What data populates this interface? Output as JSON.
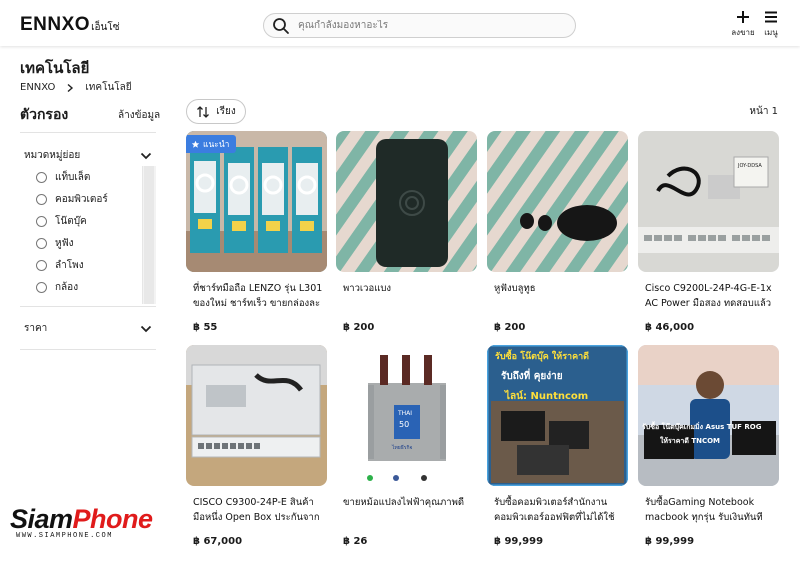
{
  "header": {
    "logo_main": "ENNXO",
    "logo_sub": "เอ็นโซ่",
    "search_placeholder": "คุณกำลังมองหาอะไร",
    "sell_label": "ลงขาย",
    "menu_label": "เมนู"
  },
  "page": {
    "title": "เทคโนโลยี",
    "breadcrumb": [
      "ENNXO",
      "เทคโนโลยี"
    ]
  },
  "sidebar": {
    "filter_title": "ตัวกรอง",
    "clear_label": "ล้างข้อมูล",
    "subcategory_title": "หมวดหมู่ย่อย",
    "subcategories": [
      "แท็บเล็ต",
      "คอมพิวเตอร์",
      "โน๊ตบุ๊ค",
      "หูฟัง",
      "ลำโพง",
      "กล้อง"
    ],
    "price_title": "ราคา"
  },
  "toolbar": {
    "sort_label": "เรียง",
    "page_label": "หน้า 1"
  },
  "products": [
    {
      "name": "ที่ชาร์ทมือถือ LENZO รุ่น L301 ของใหม่ ชาร์ทเร็ว ขายกล่องละ",
      "price": "฿ 55",
      "badge": "แนะนำ"
    },
    {
      "name": "พาวเวอแบง",
      "price": "฿ 200"
    },
    {
      "name": "หูฟังบลูทูธ",
      "price": "฿ 200"
    },
    {
      "name": "Cisco C9200L-24P-4G-E-1x AC Power มือสอง ทดสอบแล้ว",
      "price": "฿ 46,000"
    },
    {
      "name": "CISCO C9300-24P-E สินค้ามือหนึ่ง Open Box ประกันจากผู้",
      "price": "฿ 67,000"
    },
    {
      "name": "ขายหม้อแปลงไฟฟ้าคุณภาพดี",
      "price": "฿ 26"
    },
    {
      "name": "รับซื้อคอมพิวเตอร์สำนักงาน คอมพิวเตอร์ออฟฟิตที่ไม่ได้ใช้",
      "price": "฿ 99,999"
    },
    {
      "name": "รับซื้อGaming Notebook macbook ทุกรุ่น รับเงินทันที",
      "price": "฿ 99,999"
    }
  ],
  "watermark": {
    "brand_black": "Siam",
    "brand_red": "Phone",
    "url": "WWW.SIAMPHONE.COM"
  },
  "image_text": {
    "p3_label": "JOY-DDSA",
    "p6_label": "THAI",
    "p6_number": "50",
    "p6_maker": "ไทยธีรกิจ",
    "p7_line1": "รับซื้อ โน๊ตบุ๊ค ให้ราคาดี",
    "p7_line2": "รับถึงที่ คุยง่าย",
    "p7_line3": "ไลน์: Nuntncom",
    "p8_line1": "รับซื้อ โน๊ตบุ๊คเกมมิ่ง Asus TUF ROG",
    "p8_line2": "ให้ราคาดี TNCOM"
  }
}
